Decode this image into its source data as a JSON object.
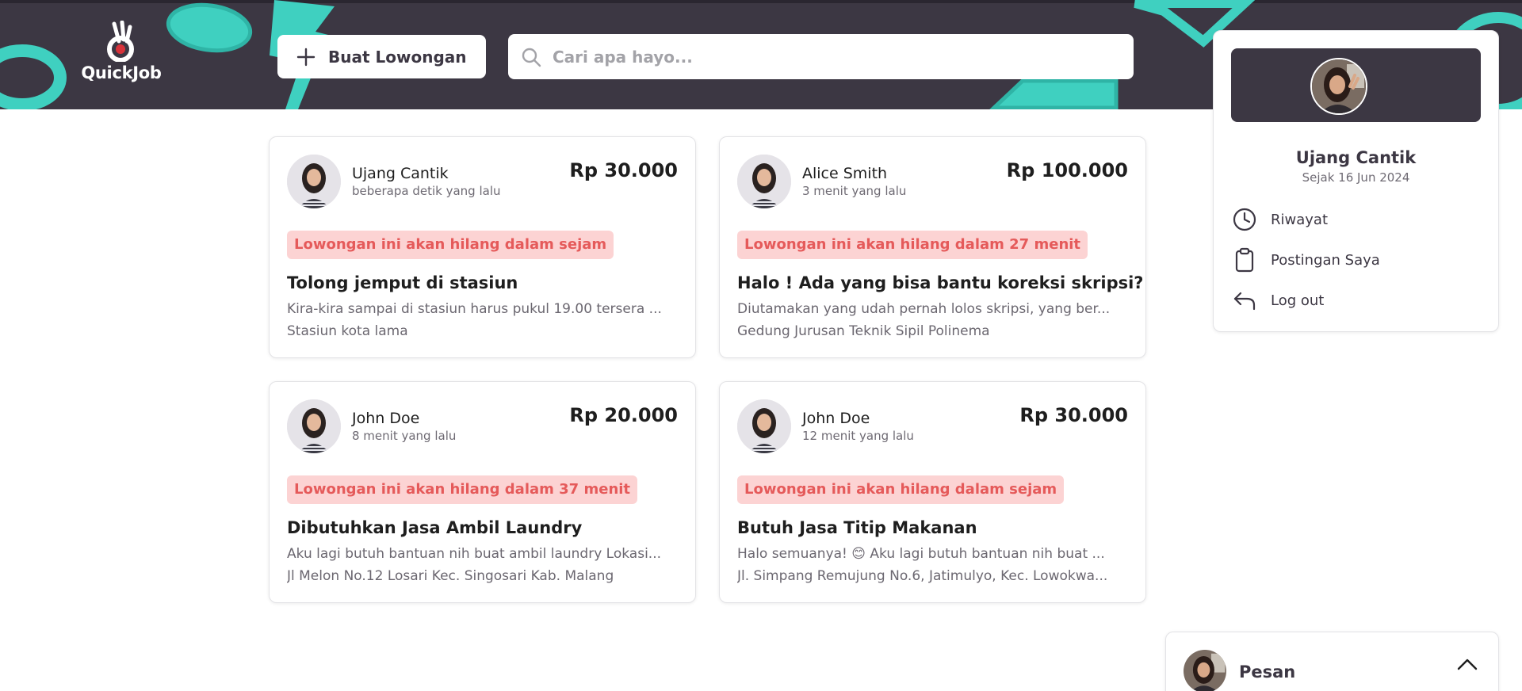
{
  "app": {
    "name": "QuickJob"
  },
  "header": {
    "create_label": "Buat Lowongan",
    "search_placeholder": "Cari apa hayo..."
  },
  "jobs": [
    {
      "user": "Ujang Cantik",
      "time": "beberapa detik yang lalu",
      "price": "Rp 30.000",
      "badge": "Lowongan ini akan hilang dalam sejam",
      "title": "Tolong jemput di stasiun",
      "description": "Kira-kira sampai di stasiun harus pukul 19.00 tersera ...",
      "location": "Stasiun kota lama"
    },
    {
      "user": "Alice Smith",
      "time": "3 menit yang lalu",
      "price": "Rp 100.000",
      "badge": "Lowongan ini akan hilang dalam 27 menit",
      "title": "Halo ! Ada yang bisa bantu koreksi skripsi?",
      "description": "Diutamakan yang udah pernah lolos skripsi, yang ber...",
      "location": "Gedung Jurusan Teknik Sipil Polinema"
    },
    {
      "user": "John Doe",
      "time": "8 menit yang lalu",
      "price": "Rp 20.000",
      "badge": "Lowongan ini akan hilang dalam 37 menit",
      "title": "Dibutuhkan Jasa Ambil Laundry",
      "description": "Aku lagi butuh bantuan nih buat ambil laundry Lokasi...",
      "location": "Jl Melon No.12 Losari Kec. Singosari Kab. Malang"
    },
    {
      "user": "John Doe",
      "time": "12 menit yang lalu",
      "price": "Rp 30.000",
      "badge": "Lowongan ini akan hilang dalam sejam",
      "title": "Butuh Jasa Titip Makanan",
      "description": "Halo semuanya! 😊 Aku lagi butuh bantuan nih buat ...",
      "location": "Jl. Simpang Remujung No.6, Jatimulyo, Kec. Lowokwa..."
    }
  ],
  "profile": {
    "name": "Ujang Cantik",
    "since": "Sejak 16 Jun 2024",
    "menu": [
      {
        "label": "Riwayat",
        "icon": "clock-icon"
      },
      {
        "label": "Postingan Saya",
        "icon": "clipboard-icon"
      },
      {
        "label": "Log out",
        "icon": "logout-arrow-icon"
      }
    ]
  },
  "chat": {
    "label": "Pesan",
    "toggle_icon": "chevron-up-icon"
  },
  "colors": {
    "header_bg": "#3c3743",
    "accent_teal": "#3fd0c0",
    "badge_bg": "#fcd3d3",
    "badge_text": "#e55a5a",
    "logo_red": "#d8323a"
  }
}
